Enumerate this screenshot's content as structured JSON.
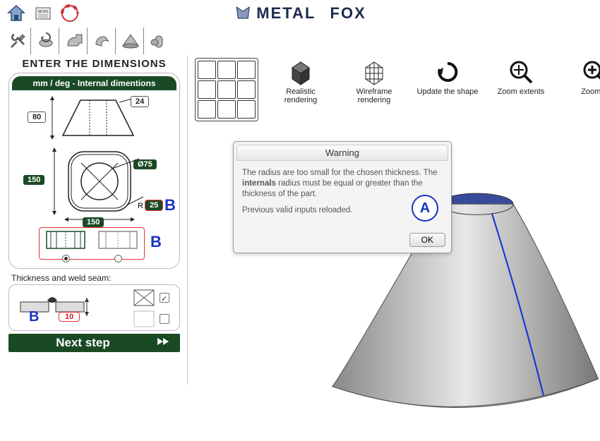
{
  "brand": {
    "name1": "METAL",
    "name2": "FOX"
  },
  "side": {
    "title": "ENTER THE DIMENSIONS",
    "panelHead": "mm / deg - Internal dimentions",
    "dims": {
      "h": "80",
      "top": "24",
      "w1": "150",
      "w2": "150",
      "d": "Ø75",
      "r": "25",
      "rprefix": "R"
    },
    "thickLabel": "Thickness and weld seam:",
    "thickVal": "10",
    "next": "Next step"
  },
  "annot": {
    "A": "A",
    "B": "B"
  },
  "vtb": {
    "b1": "Realistic rendering",
    "b2": "Wireframe rendering",
    "b3": "Update the shape",
    "b4": "Zoom extents",
    "b5": "Zoom +"
  },
  "dialog": {
    "title": "Warning",
    "line1": "The radius are too small for the chosen thickness. The ",
    "bold": "internals",
    "line1b": " radius must be equal or greater than the thickness of the part.",
    "line2": "Previous valid inputs reloaded.",
    "ok": "OK"
  }
}
